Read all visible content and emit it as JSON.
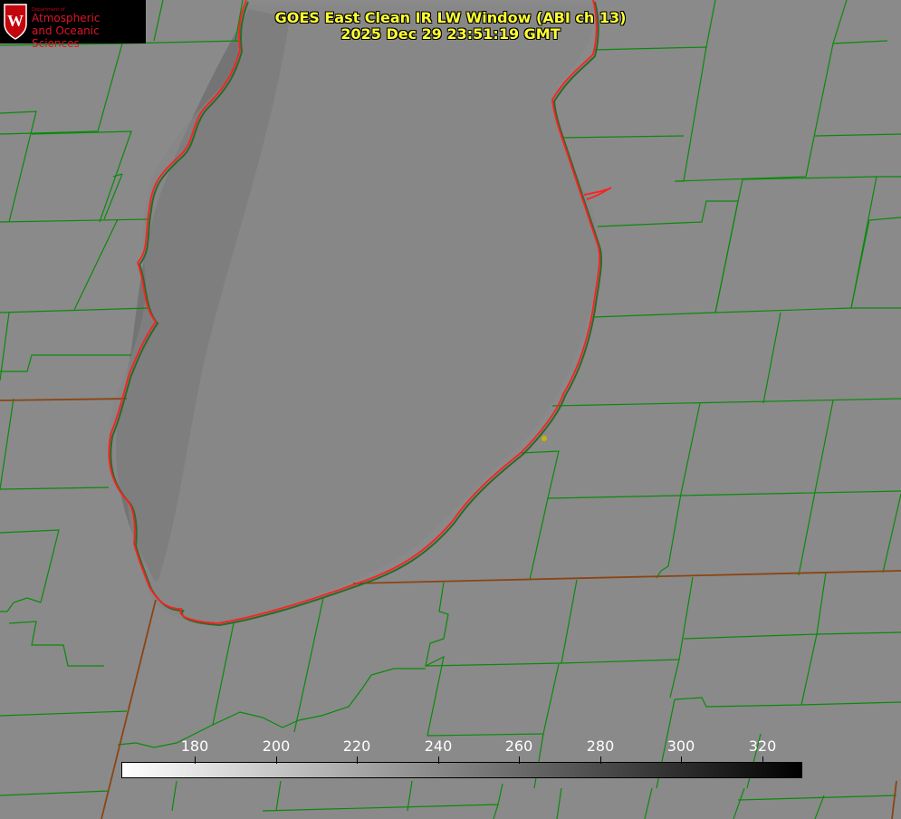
{
  "logo": {
    "dept": "Department of",
    "line1": "Atmospheric",
    "line2": "and Oceanic Sciences"
  },
  "title": {
    "line1": "GOES East Clean IR LW Window (ABI ch 13)",
    "line2": "2025 Dec 29 23:51:19 GMT"
  },
  "colorbar": {
    "ticks": [
      "180",
      "200",
      "220",
      "240",
      "260",
      "280",
      "300",
      "320"
    ]
  },
  "colors": {
    "background": "#8a8a8a",
    "county_lines": "#0a8a0a",
    "state_lines": "#8b4513",
    "lake_outline": "#ff2020",
    "title_text": "#ffff33",
    "marker": "#c8b400"
  }
}
